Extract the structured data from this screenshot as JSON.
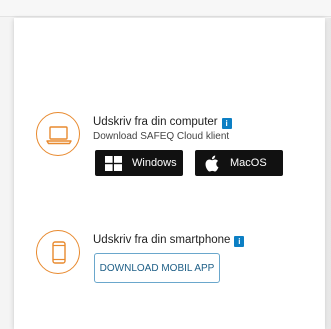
{
  "computer_section": {
    "title": "Udskriv fra din computer",
    "subtitle": "Download SAFEQ Cloud klient",
    "info_badge": "i",
    "buttons": {
      "windows_label": "Windows",
      "macos_label": "MacOS"
    },
    "icon": "laptop-icon"
  },
  "smartphone_section": {
    "title": "Udskriv fra din smartphone",
    "info_badge": "i",
    "button_label": "DOWNLOAD MOBIL APP",
    "icon": "smartphone-icon"
  },
  "colors": {
    "accent_orange": "#e88a2f",
    "info_blue": "#0c7fc4",
    "button_dark": "#111111",
    "outline_blue": "#6aa7cc"
  }
}
